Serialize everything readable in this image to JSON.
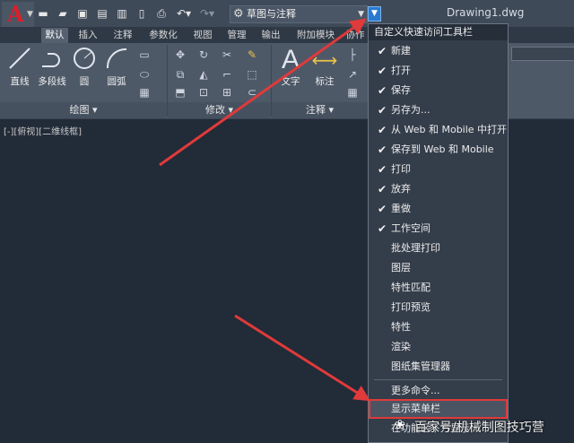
{
  "app": {
    "logo": "A",
    "filename": "Drawing1.dwg"
  },
  "qat": {
    "icons": [
      "new-icon",
      "open-icon",
      "save-icon",
      "saveas-icon",
      "web-icon",
      "mobile-icon",
      "print-icon",
      "undo-icon",
      "redo-icon"
    ],
    "workspace": "草图与注释"
  },
  "tabs": [
    "默认",
    "插入",
    "注释",
    "参数化",
    "视图",
    "管理",
    "输出",
    "附加模块",
    "协作"
  ],
  "ribbon": {
    "draw": {
      "line": "直线",
      "polyline": "多段线",
      "circle": "圆",
      "arc": "圆弧",
      "footer": "绘图"
    },
    "modify": {
      "footer": "修改"
    },
    "annotation": {
      "text": "文字",
      "dim": "标注",
      "footer": "注释"
    }
  },
  "viewport_label": "[-][俯视][二维线框]",
  "menu": {
    "title": "自定义快速访问工具栏",
    "items": [
      {
        "label": "新建",
        "checked": "✔"
      },
      {
        "label": "打开",
        "checked": "✔"
      },
      {
        "label": "保存",
        "checked": "✔"
      },
      {
        "label": "另存为...",
        "checked": "✔"
      },
      {
        "label": "从 Web 和 Mobile 中打开",
        "checked": "✔"
      },
      {
        "label": "保存到 Web 和 Mobile",
        "checked": "✔"
      },
      {
        "label": "打印",
        "checked": "✔"
      },
      {
        "label": "放弃",
        "checked": "✔"
      },
      {
        "label": "重做",
        "checked": "✔"
      },
      {
        "label": "工作空间",
        "checked": "✔"
      },
      {
        "label": "批处理打印",
        "checked": ""
      },
      {
        "label": "图层",
        "checked": ""
      },
      {
        "label": "特性匹配",
        "checked": ""
      },
      {
        "label": "打印预览",
        "checked": ""
      },
      {
        "label": "特性",
        "checked": ""
      },
      {
        "label": "渲染",
        "checked": ""
      },
      {
        "label": "图纸集管理器",
        "checked": ""
      }
    ],
    "more": "更多命令...",
    "show_menubar": "显示菜单栏",
    "below": "在功能区下方显示"
  },
  "watermark": "百家号/机械制图技巧营",
  "colors": {
    "accent": "#2a7ad0",
    "arrow": "#e03a3a",
    "menu_bg": "#343d4a",
    "canvas": "#222b38"
  }
}
